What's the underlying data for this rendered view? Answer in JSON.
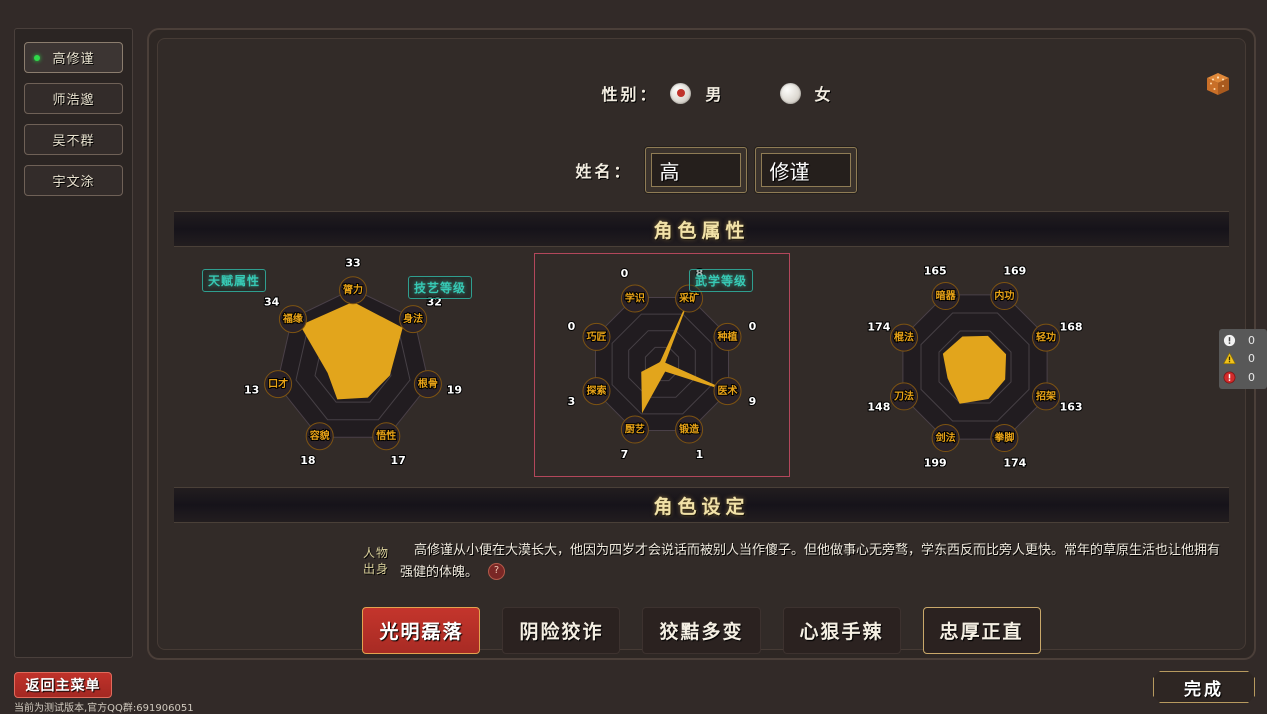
{
  "sidebar": {
    "characters": [
      {
        "name": "高修谨",
        "active": true
      },
      {
        "name": "师浩邈",
        "active": false
      },
      {
        "name": "吴不群",
        "active": false
      },
      {
        "name": "宇文涂",
        "active": false
      }
    ]
  },
  "form": {
    "gender_label": "性别：",
    "gender_options": [
      {
        "label": "男",
        "selected": true
      },
      {
        "label": "女",
        "selected": false
      }
    ],
    "name_label": "姓名：",
    "surname_value": "高",
    "givenname_value": "修谨",
    "dice_icon": "dice-icon"
  },
  "banners": {
    "attributes": "角色属性",
    "setup": "角色设定"
  },
  "chart_data": [
    {
      "type": "radar",
      "title": "天赋属性",
      "categories": [
        "膂力",
        "身法",
        "根骨",
        "悟性",
        "容貌",
        "口才",
        "福缘"
      ],
      "values": [
        33,
        32,
        19,
        17,
        18,
        13,
        34
      ],
      "max": 40,
      "rings": 4,
      "highlighted": false
    },
    {
      "type": "radar",
      "title": "技艺等级",
      "categories": [
        "采矿",
        "种植",
        "医术",
        "锻造",
        "厨艺",
        "探索",
        "巧匠",
        "学识"
      ],
      "values": [
        8,
        0,
        9,
        1,
        7,
        3,
        0,
        0
      ],
      "max": 10,
      "rings": 4,
      "highlighted": true
    },
    {
      "type": "radar",
      "title": "武学等级",
      "categories": [
        "内功",
        "轻功",
        "招架",
        "拳脚",
        "剑法",
        "刀法",
        "棍法",
        "暗器"
      ],
      "values": [
        169,
        168,
        163,
        174,
        199,
        148,
        174,
        165
      ],
      "max": 400,
      "rings": 4,
      "highlighted": false
    }
  ],
  "story": {
    "label": "人物\n出身",
    "label_line1": "人物",
    "label_line2": "出身",
    "text": "高修谨从小便在大漠长大，他因为四岁才会说话而被别人当作傻子。但他做事心无旁骛，学东西反而比旁人更快。常年的草原生活也让他拥有强健的体魄。",
    "help_icon": "?"
  },
  "traits": [
    {
      "label": "光明磊落",
      "state": "selected"
    },
    {
      "label": "阴险狡诈",
      "state": "normal"
    },
    {
      "label": "狡黠多变",
      "state": "normal"
    },
    {
      "label": "心狠手辣",
      "state": "normal"
    },
    {
      "label": "忠厚正直",
      "state": "hover"
    }
  ],
  "footer": {
    "back_label": "返回主菜单",
    "version_text": "当前为测试版本,官方QQ群:691906051",
    "finish_label": "完成"
  },
  "console": {
    "info_count": "0",
    "warning_count": "0",
    "error_count": "0"
  },
  "colors": {
    "accent_gold": "#e8a317",
    "fill_gold": "#e2a51c",
    "tag_teal": "#37c9b4",
    "selected_red": "#c4352c",
    "highlight_border": "#b3475b"
  }
}
